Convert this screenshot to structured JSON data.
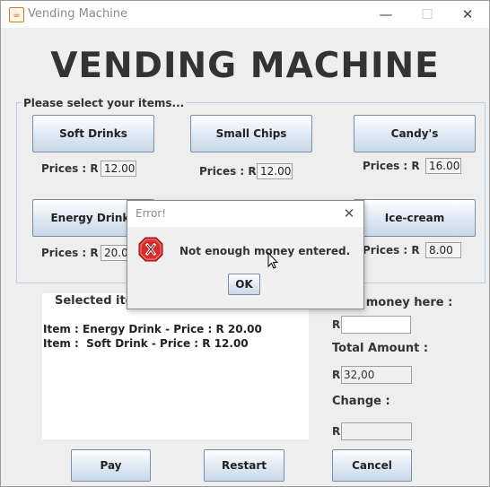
{
  "window": {
    "title": "Vending Machine",
    "minimize": "—",
    "maximize": "☐",
    "close": "✕"
  },
  "heading": "VENDING MACHINE",
  "items_panel": {
    "label": "Please select your items...",
    "items": [
      {
        "button": "Soft Drinks",
        "price_label": "Prices : R",
        "price": "12.00"
      },
      {
        "button": "Small Chips",
        "price_label": "Prices : R",
        "price": "12.00"
      },
      {
        "button": "Candy's",
        "price_label": "Prices : R",
        "price": "16.00"
      },
      {
        "button": "Energy Drinks",
        "price_label": "Prices : R",
        "price": "20.00"
      },
      {
        "button": "Ice-cream",
        "price_label": "Prices : R",
        "price": "8.00"
      }
    ]
  },
  "selected_items": {
    "title": "Selected item",
    "lines": [
      "Item : Energy Drink - Price : R 20.00",
      "Item :  Soft Drink - Price : R 12.00"
    ]
  },
  "money": {
    "insert_label": "t money here :",
    "insert_prefix": "R",
    "insert_value": "",
    "total_label": "Total Amount :",
    "total_prefix": "R",
    "total_value": "32,00",
    "change_label": "Change :",
    "change_prefix": "R",
    "change_value": ""
  },
  "actions": {
    "pay": "Pay",
    "restart": "Restart",
    "cancel": "Cancel"
  },
  "dialog": {
    "title": "Error!",
    "close": "✕",
    "icon": "error-icon",
    "message": "Not enough money entered.",
    "ok": "OK"
  },
  "colors": {
    "error_red": "#d92b2b",
    "panel_border": "#b8cfe5",
    "button_border": "#7a8ea8"
  }
}
